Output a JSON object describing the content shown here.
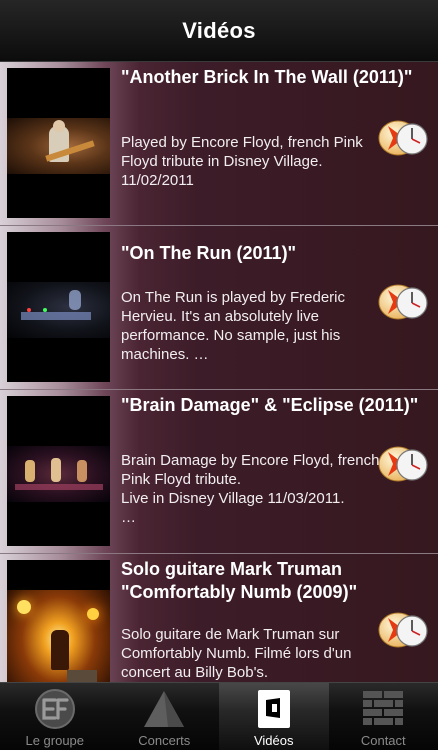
{
  "header": {
    "title": "Vidéos"
  },
  "videos": [
    {
      "title": "\"Another Brick In The Wall (2011)\"",
      "description": "Played by Encore Floyd, french Pink Floyd tribute in Disney Village. 11/02/2011"
    },
    {
      "title": "\"On The Run (2011)\"",
      "description": "On The Run is played by Frederic Hervieu. It's an absolutely live performance. No sample, just his machines. …"
    },
    {
      "title": "\"Brain Damage\" & \"Eclipse (2011)\"",
      "description": "Brain Damage by Encore Floyd, french Pink Floyd tribute.\nLive in Disney Village 11/03/2011.\n …"
    },
    {
      "title": "Solo guitare Mark Truman \"Comfortably Numb (2009)\"",
      "description": "Solo guitare de Mark Truman sur Comfortably Numb. Filmé  lors d'un concert au Billy Bob's."
    }
  ],
  "tabs": [
    {
      "label": "Le groupe",
      "icon": "ef-logo-icon"
    },
    {
      "label": "Concerts",
      "icon": "pyramid-icon"
    },
    {
      "label": "Vidéos",
      "icon": "video-frame-icon",
      "active": true
    },
    {
      "label": "Contact",
      "icon": "brick-wall-icon"
    }
  ]
}
